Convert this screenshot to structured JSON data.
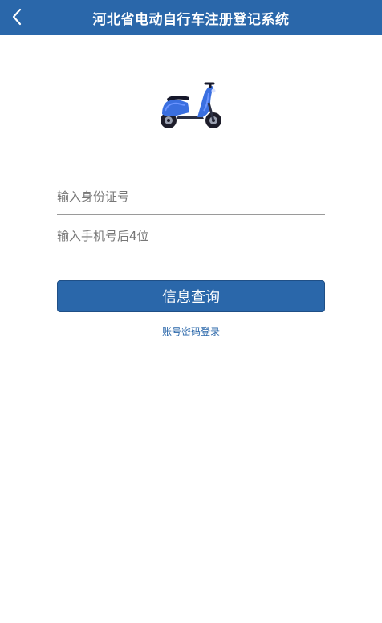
{
  "header": {
    "title": "河北省电动自行车注册登记系统",
    "back_icon": "chevron-left-icon",
    "background": "#2a67aa"
  },
  "logo": {
    "icon": "electric-scooter-icon",
    "color": "#3a6fe0"
  },
  "form": {
    "id_placeholder": "输入身份证号",
    "id_value": "",
    "phone_placeholder": "输入手机号后4位",
    "phone_value": ""
  },
  "actions": {
    "query_label": "信息查询",
    "login_link_label": "账号密码登录",
    "accent": "#2a67aa"
  }
}
